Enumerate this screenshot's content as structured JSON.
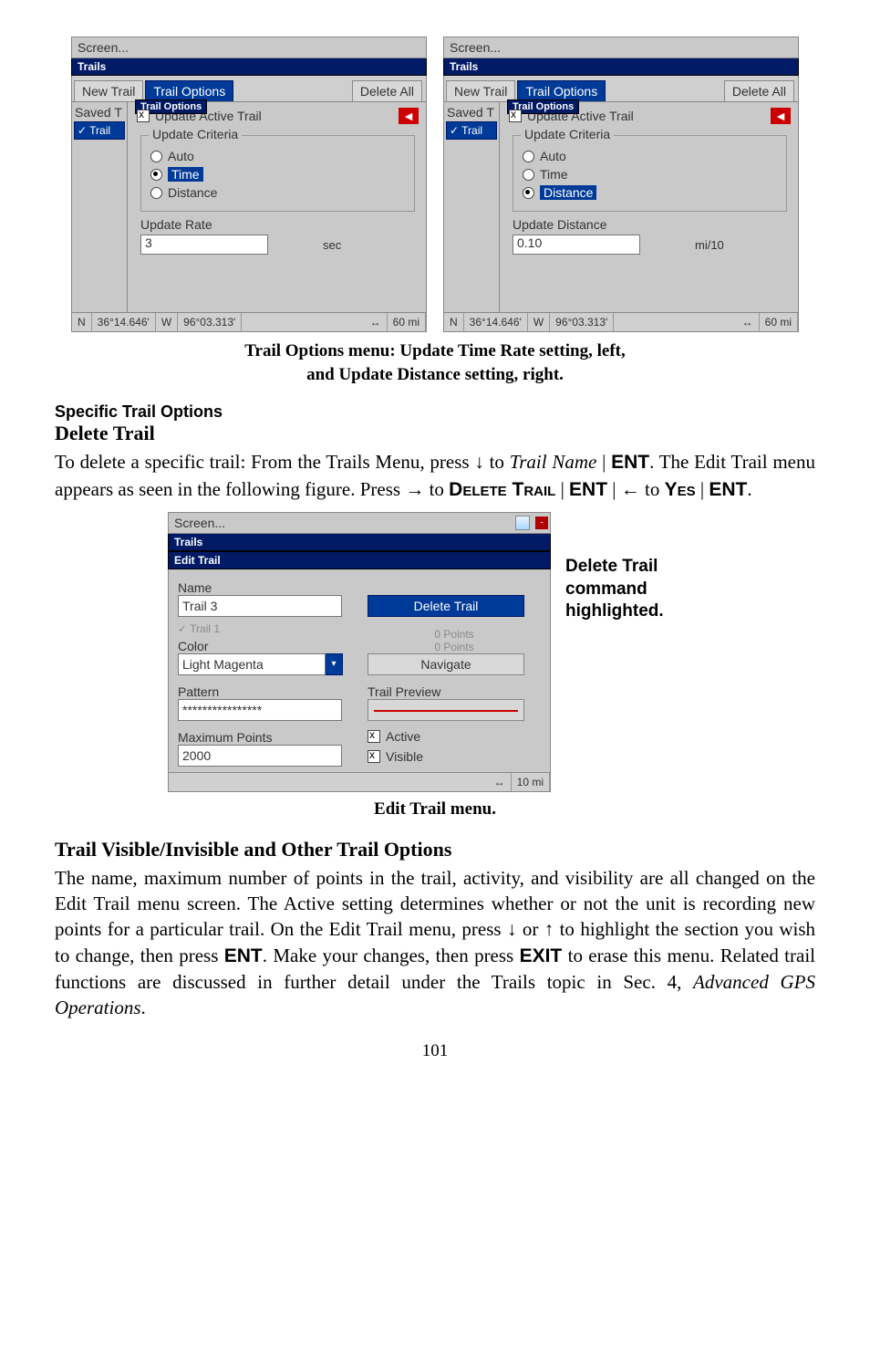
{
  "fig1": {
    "left": {
      "topbar": "Screen...",
      "trails_hdr": "Trails",
      "tabs": {
        "new": "New Trail",
        "opts": "Trail Options",
        "del": "Delete All"
      },
      "side": {
        "saved": "Saved T",
        "trail": "Trail"
      },
      "pill": "Trail Options",
      "update_active": "Update Active Trail",
      "criteria_legend": "Update Criteria",
      "radios": {
        "auto": "Auto",
        "time": "Time",
        "distance": "Distance"
      },
      "rate_label": "Update Rate",
      "rate_value": "3",
      "rate_unit": "sec",
      "status": {
        "n": "N",
        "lat": "36°14.646'",
        "w": "W",
        "lon": "96°03.313'",
        "arrow": "↔",
        "dist": "60 mi"
      }
    },
    "right": {
      "topbar": "Screen...",
      "trails_hdr": "Trails",
      "tabs": {
        "new": "New Trail",
        "opts": "Trail Options",
        "del": "Delete All"
      },
      "side": {
        "saved": "Saved T",
        "trail": "Trail"
      },
      "pill": "Trail Options",
      "update_active": "Update Active Trail",
      "criteria_legend": "Update Criteria",
      "radios": {
        "auto": "Auto",
        "time": "Time",
        "distance": "Distance"
      },
      "rate_label": "Update Distance",
      "rate_value": "0.10",
      "rate_unit": "mi/10",
      "status": {
        "n": "N",
        "lat": "36°14.646'",
        "w": "W",
        "lon": "96°03.313'",
        "arrow": "↔",
        "dist": "60 mi"
      }
    }
  },
  "caption1_a": "Trail Options menu: Update Time Rate setting, left,",
  "caption1_b": "and Update Distance setting, right.",
  "sec_specific": "Specific Trail Options",
  "h_delete": "Delete Trail",
  "p_delete_1": "To delete a specific trail: From the Trails Menu, press ↓ to ",
  "p_delete_trailname": "Trail Name",
  "p_delete_2": ". The Edit Trail menu appears as seen in the following figure. Press → to ",
  "sc_delete": "Delete Trail",
  "sc_yes": "Yes",
  "kw_ent": "ENT",
  "p_arrowback": " | ← to ",
  "fig2": {
    "topbar": "Screen...",
    "trails_hdr": "Trails",
    "et_hdr": "Edit Trail",
    "name_lbl": "Name",
    "name_val": "Trail 3",
    "del_btn": "Delete Trail",
    "ghost1": "0 Points",
    "ghost2": "0 Points",
    "color_lbl": "Color",
    "color_val": "Light Magenta",
    "nav_btn": "Navigate",
    "pattern_lbl": "Pattern",
    "pattern_val": "****************",
    "preview_lbl": "Trail Preview",
    "max_lbl": "Maximum Points",
    "max_val": "2000",
    "active": "Active",
    "visible": "Visible",
    "status": {
      "arrow": "↔",
      "dist": "10 mi"
    }
  },
  "callout": "Delete Trail command highlighted.",
  "caption2": "Edit Trail menu.",
  "h_visible": "Trail Visible/Invisible and Other Trail Options",
  "p_visible": "The name, maximum number of points in the trail, activity, and visibility are all changed on the Edit Trail menu screen. The Active setting determines whether or not the unit is recording new points for a particular trail. On the Edit Trail menu, press ↓ or ↑ to highlight the section you wish to change, then press ",
  "p_visible_2": ". Make your changes, then press ",
  "kw_exit": "EXIT",
  "p_visible_3": " to erase this menu. Related trail functions are discussed in further detail under the Trails topic in Sec. 4, ",
  "it_adv": "Advanced GPS Operations",
  "p_visible_4": ".",
  "pageno": "101"
}
